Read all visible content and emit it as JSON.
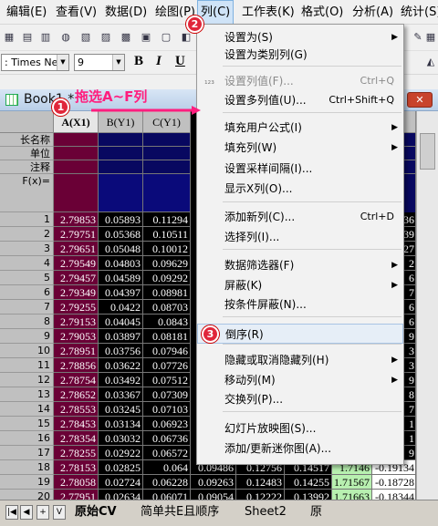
{
  "menubar": {
    "items": [
      "编辑(E)",
      "查看(V)",
      "数据(D)",
      "绘图(P)",
      "列(C)",
      "工作表(K)",
      "格式(O)",
      "分析(A)",
      "统计(S)"
    ]
  },
  "format_toolbar": {
    "font_name": ": Times New",
    "font_size": "9",
    "bold": "B",
    "italic": "I",
    "underline": "U"
  },
  "workbook": {
    "title": "Book1 *",
    "close_label": "✕",
    "columns": [
      "A(X1)",
      "B(Y1)",
      "C(Y1)"
    ],
    "meta_labels": [
      "长名称",
      "单位",
      "注释",
      "F(x)="
    ],
    "rows": [
      {
        "n": "1",
        "a": "2.79853",
        "b": "0.05893",
        "c": "0.11294"
      },
      {
        "n": "2",
        "a": "2.79751",
        "b": "0.05368",
        "c": "0.10511"
      },
      {
        "n": "3",
        "a": "2.79651",
        "b": "0.05048",
        "c": "0.10012"
      },
      {
        "n": "4",
        "a": "2.79549",
        "b": "0.04803",
        "c": "0.09629"
      },
      {
        "n": "5",
        "a": "2.79457",
        "b": "0.04589",
        "c": "0.09292"
      },
      {
        "n": "6",
        "a": "2.79349",
        "b": "0.04397",
        "c": "0.08981"
      },
      {
        "n": "7",
        "a": "2.79255",
        "b": "0.0422",
        "c": "0.08703"
      },
      {
        "n": "8",
        "a": "2.79153",
        "b": "0.04045",
        "c": "0.0843"
      },
      {
        "n": "9",
        "a": "2.79053",
        "b": "0.03897",
        "c": "0.08181"
      },
      {
        "n": "10",
        "a": "2.78951",
        "b": "0.03756",
        "c": "0.07946"
      },
      {
        "n": "11",
        "a": "2.78856",
        "b": "0.03622",
        "c": "0.07726"
      },
      {
        "n": "12",
        "a": "2.78754",
        "b": "0.03492",
        "c": "0.07512"
      },
      {
        "n": "13",
        "a": "2.78652",
        "b": "0.03367",
        "c": "0.07309"
      },
      {
        "n": "14",
        "a": "2.78553",
        "b": "0.03245",
        "c": "0.07103"
      },
      {
        "n": "15",
        "a": "2.78453",
        "b": "0.03134",
        "c": "0.06923"
      },
      {
        "n": "16",
        "a": "2.78354",
        "b": "0.03032",
        "c": "0.06736"
      },
      {
        "n": "17",
        "a": "2.78255",
        "b": "0.02922",
        "c": "0.06572"
      },
      {
        "n": "18",
        "a": "2.78153",
        "b": "0.02825",
        "c": "0.064"
      },
      {
        "n": "19",
        "a": "2.78058",
        "b": "0.02724",
        "c": "0.06228"
      },
      {
        "n": "20",
        "a": "2.77951",
        "b": "0.02634",
        "c": "0.06071"
      }
    ],
    "right_partial": [
      "36",
      "39",
      "27",
      "2",
      "6",
      "7",
      "6",
      "6",
      "9",
      "3",
      "3",
      "9",
      "8",
      "7",
      "1",
      "1",
      "9"
    ],
    "extra_rows": [
      {
        "d": "0.09486",
        "e": "0.12756",
        "f": "0.14517",
        "g": "1.7146",
        "h": "-0.19134"
      },
      {
        "d": "0.09263",
        "e": "0.12483",
        "f": "0.14255",
        "g": "1.71567",
        "h": "-0.18728"
      },
      {
        "d": "0.09054",
        "e": "0.12222",
        "f": "0.13992",
        "g": "1.71663",
        "h": "-0.18344"
      }
    ],
    "sheet_tabs": [
      "原始CV",
      "简单共E且顺序",
      "Sheet2",
      "原"
    ],
    "sheet_nav": [
      "|◀",
      "◀",
      "+",
      "V"
    ]
  },
  "context_menu": {
    "items": [
      {
        "label": "设置为(S)",
        "shortcut": "",
        "submenu": true,
        "disabled": false
      },
      {
        "label": "设置为类别列(G)",
        "shortcut": "",
        "submenu": false,
        "disabled": false
      },
      {
        "label": "设置列值(F)...",
        "shortcut": "Ctrl+Q",
        "submenu": false,
        "disabled": true
      },
      {
        "label": "设置多列值(U)...",
        "shortcut": "Ctrl+Shift+Q",
        "submenu": false,
        "disabled": false
      },
      {
        "label": "填充用户公式(I)",
        "shortcut": "",
        "submenu": true,
        "disabled": false
      },
      {
        "label": "填充列(W)",
        "shortcut": "",
        "submenu": true,
        "disabled": false
      },
      {
        "label": "设置采样间隔(I)...",
        "shortcut": "",
        "submenu": false,
        "disabled": false
      },
      {
        "label": "显示X列(O)...",
        "shortcut": "",
        "submenu": false,
        "disabled": false
      },
      {
        "label": "添加新列(C)...",
        "shortcut": "Ctrl+D",
        "submenu": false,
        "disabled": false
      },
      {
        "label": "选择列(I)...",
        "shortcut": "",
        "submenu": false,
        "disabled": false
      },
      {
        "label": "数据筛选器(F)",
        "shortcut": "",
        "submenu": true,
        "disabled": false
      },
      {
        "label": "屏蔽(K)",
        "shortcut": "",
        "submenu": true,
        "disabled": false
      },
      {
        "label": "按条件屏蔽(N)...",
        "shortcut": "",
        "submenu": false,
        "disabled": false
      },
      {
        "label": "倒序(R)",
        "shortcut": "",
        "submenu": false,
        "disabled": false
      },
      {
        "label": "隐藏或取消隐藏列(H)",
        "shortcut": "",
        "submenu": true,
        "disabled": false
      },
      {
        "label": "移动列(M)",
        "shortcut": "",
        "submenu": true,
        "disabled": false
      },
      {
        "label": "交换列(P)...",
        "shortcut": "",
        "submenu": false,
        "disabled": false
      },
      {
        "label": "幻灯片放映图(S)...",
        "shortcut": "",
        "submenu": false,
        "disabled": false
      },
      {
        "label": "添加/更新迷你图(A)...",
        "shortcut": "",
        "submenu": false,
        "disabled": false
      }
    ],
    "highlighted_index": 13
  },
  "annotations": {
    "drag_text": "拖选A~F列",
    "badges": [
      "1",
      "2",
      "3"
    ]
  },
  "colors": {
    "selected_column": "#6a0036",
    "highlight_text": "#ff1e7e",
    "badge": "#e0263a",
    "green_cell": "#b8f0b0"
  }
}
